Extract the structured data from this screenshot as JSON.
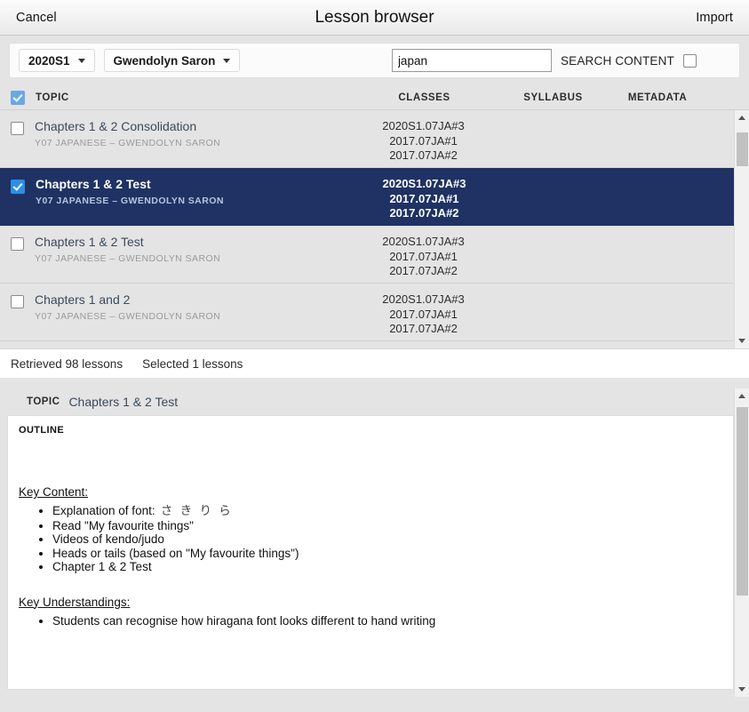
{
  "titlebar": {
    "cancel_label": "Cancel",
    "title": "Lesson browser",
    "import_label": "Import"
  },
  "filterbar": {
    "term_dropdown": "2020S1",
    "teacher_dropdown": "Gwendolyn Saron",
    "search_value": "japan",
    "search_placeholder": "",
    "search_content_label": "SEARCH CONTENT",
    "search_content_checked": false
  },
  "table": {
    "select_all_checked": true,
    "columns": {
      "topic": "TOPIC",
      "classes": "CLASSES",
      "syllabus": "SYLLABUS",
      "metadata": "METADATA"
    },
    "rows": [
      {
        "checked": false,
        "selected": false,
        "title": "Chapters 1 & 2 Consolidation",
        "subject": "Y07 JAPANESE",
        "separator": "–",
        "teacher": "GWENDOLYN SARON",
        "classes": [
          "2020S1.07JA#3",
          "2017.07JA#1",
          "2017.07JA#2"
        ],
        "syllabus": "",
        "metadata": ""
      },
      {
        "checked": true,
        "selected": true,
        "title": "Chapters 1 & 2 Test",
        "subject": "Y07 JAPANESE",
        "separator": "–",
        "teacher": "GWENDOLYN SARON",
        "classes": [
          "2020S1.07JA#3",
          "2017.07JA#1",
          "2017.07JA#2"
        ],
        "syllabus": "",
        "metadata": ""
      },
      {
        "checked": false,
        "selected": false,
        "title": "Chapters 1 & 2 Test",
        "subject": "Y07 JAPANESE",
        "separator": "–",
        "teacher": "GWENDOLYN SARON",
        "classes": [
          "2020S1.07JA#3",
          "2017.07JA#1",
          "2017.07JA#2"
        ],
        "syllabus": "",
        "metadata": ""
      },
      {
        "checked": false,
        "selected": false,
        "title": "Chapters 1 and 2",
        "subject": "Y07 JAPANESE",
        "separator": "–",
        "teacher": "GWENDOLYN SARON",
        "classes": [
          "2020S1.07JA#3",
          "2017.07JA#1",
          "2017.07JA#2"
        ],
        "syllabus": "",
        "metadata": ""
      }
    ]
  },
  "statusbar": {
    "retrieved": "Retrieved 98 lessons",
    "selected": "Selected 1 lessons"
  },
  "detail": {
    "topic_label": "TOPIC",
    "topic_value": "Chapters 1 & 2 Test",
    "outline_label": "OUTLINE",
    "key_content_heading": "Key Content:",
    "key_content_items": [
      "Explanation of font: さ き り ら",
      "Read \"My favourite things\"",
      "Videos of kendo/judo",
      "Heads or tails (based on \"My favourite things\")",
      "Chapter 1 & 2 Test"
    ],
    "key_understandings_heading": "Key Understandings:",
    "key_understandings_items": [
      "Students can recognise how hiragana font looks different to hand writing"
    ]
  },
  "colors": {
    "selected_row": "#1f3263",
    "accent_checkbox": "#2b8fe8",
    "header_checkbox": "#69a7e8",
    "panel_bg": "#e4e4e4",
    "scroll_thumb": "#c1c1c1"
  }
}
